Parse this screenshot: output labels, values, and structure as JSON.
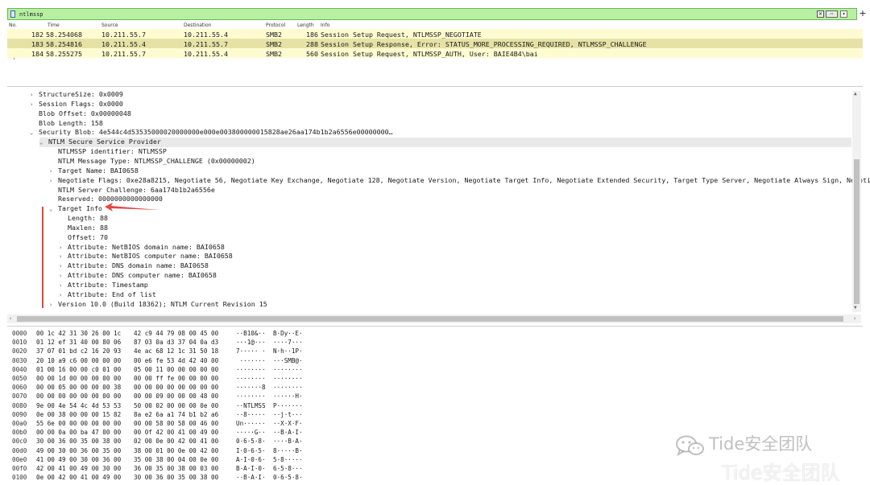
{
  "filter": {
    "value": "ntlmssp",
    "clear_icon": "✕",
    "apply_icon": "⇨",
    "dropdown_icon": "▾",
    "add_icon": "+"
  },
  "packet_list": {
    "columns": [
      "No.",
      "Time",
      "Source",
      "Destination",
      "Protocol",
      "Length",
      "Info"
    ],
    "rows": [
      {
        "no": "182",
        "time": "58.254068",
        "source": "10.211.55.7",
        "destination": "10.211.55.4",
        "protocol": "SMB2",
        "length": "186",
        "info": "Session Setup Request, NTLMSSP_NEGOTIATE"
      },
      {
        "no": "183",
        "time": "58.254816",
        "source": "10.211.55.4",
        "destination": "10.211.55.7",
        "protocol": "SMB2",
        "length": "288",
        "info": "Session Setup Response, Error: STATUS_MORE_PROCESSING_REQUIRED, NTLMSSP_CHALLENGE"
      },
      {
        "no": "184",
        "time": "58.255275",
        "source": "10.211.55.7",
        "destination": "10.211.55.4",
        "protocol": "SMB2",
        "length": "560",
        "info": "Session Setup Request, NTLMSSP_AUTH, User: BAIE4B4\\bai"
      }
    ]
  },
  "details": [
    {
      "indent": 0,
      "arrow": "›",
      "text": "StructureSize: 0x0009"
    },
    {
      "indent": 0,
      "arrow": "›",
      "text": "Session Flags: 0x0000"
    },
    {
      "indent": 0,
      "arrow": "",
      "text": "Blob Offset: 0x00000048"
    },
    {
      "indent": 0,
      "arrow": "",
      "text": "Blob Length: 158"
    },
    {
      "indent": 0,
      "arrow": "⌄",
      "text": "Security Blob: 4e544c4d53535000020000000e000e003800000015828ae26aa174b1b2a6556e00000000…"
    },
    {
      "indent": 1,
      "arrow": "⌄",
      "text": "NTLM Secure Service Provider",
      "selected": true
    },
    {
      "indent": 2,
      "arrow": "",
      "text": "NTLMSSP identifier: NTLMSSP"
    },
    {
      "indent": 2,
      "arrow": "",
      "text": "NTLM Message Type: NTLMSSP_CHALLENGE (0x00000002)"
    },
    {
      "indent": 2,
      "arrow": "›",
      "text": "Target Name: BAI0658"
    },
    {
      "indent": 2,
      "arrow": "›",
      "text": "Negotiate Flags: 0xe28a8215, Negotiate 56, Negotiate Key Exchange, Negotiate 128, Negotiate Version, Negotiate Target Info, Negotiate Extended Security, Target Type Server, Negotiate Always Sign, Negotia"
    },
    {
      "indent": 2,
      "arrow": "",
      "text": "NTLM Server Challenge: 6aa174b1b2a6556e"
    },
    {
      "indent": 2,
      "arrow": "",
      "text": "Reserved: 0000000000000000"
    },
    {
      "indent": 2,
      "arrow": "⌄",
      "text": "Target Info"
    },
    {
      "indent": 3,
      "arrow": "",
      "text": "Length: 88"
    },
    {
      "indent": 3,
      "arrow": "",
      "text": "Maxlen: 88"
    },
    {
      "indent": 3,
      "arrow": "",
      "text": "Offset: 70"
    },
    {
      "indent": 3,
      "arrow": "›",
      "text": "Attribute: NetBIOS domain name: BAI0658"
    },
    {
      "indent": 3,
      "arrow": "›",
      "text": "Attribute: NetBIOS computer name: BAI0658"
    },
    {
      "indent": 3,
      "arrow": "›",
      "text": "Attribute: DNS domain name: BAI0658"
    },
    {
      "indent": 3,
      "arrow": "›",
      "text": "Attribute: DNS computer name: BAI0658"
    },
    {
      "indent": 3,
      "arrow": "›",
      "text": "Attribute: Timestamp"
    },
    {
      "indent": 3,
      "arrow": "›",
      "text": "Attribute: End of list"
    },
    {
      "indent": 2,
      "arrow": "›",
      "text": "Version 10.0 (Build 18362); NTLM Current Revision 15"
    }
  ],
  "hex": [
    {
      "off": "0000",
      "b1": "00 1c 42 31 30 26 00 1c",
      "b2": "42 c9 44 79 08 00 45 00",
      "a1": "··B10&··",
      "a2": "B·Dy··E·"
    },
    {
      "off": "0010",
      "b1": "01 12 ef 31 40 00 80 06",
      "b2": "87 03 0a d3 37 04 0a d3",
      "a1": "···1@···",
      "a2": "····7···"
    },
    {
      "off": "0020",
      "b1": "37 07 01 bd c2 16 20 93",
      "b2": "4e ac 68 12 1c 31 50 18",
      "a1": "7····· ·",
      "a2": "N·h··1P·"
    },
    {
      "off": "0030",
      "b1": "20 10 a9 c6 00 00 00 00",
      "b2": "00 e6 fe 53 4d 42 40 00",
      "a1": " ·······",
      "a2": "···SMB@·"
    },
    {
      "off": "0040",
      "b1": "01 00 16 00 00 c0 01 00",
      "b2": "05 00 11 00 00 00 00 00",
      "a1": "········",
      "a2": "········"
    },
    {
      "off": "0050",
      "b1": "00 00 1d 00 00 00 00 00",
      "b2": "00 00 ff fe 00 00 00 00",
      "a1": "········",
      "a2": "········"
    },
    {
      "off": "0060",
      "b1": "00 00 05 00 00 00 00 38",
      "b2": "00 00 00 00 00 00 00 00",
      "a1": "·······8",
      "a2": "········"
    },
    {
      "off": "0070",
      "b1": "00 00 00 00 00 00 00 00",
      "b2": "00 00 09 00 00 00 48 00",
      "a1": "········",
      "a2": "······H·"
    },
    {
      "off": "0080",
      "b1": "9e 00 4e 54 4c 4d 53 53",
      "b2": "50 00 02 00 00 00 0e 00",
      "a1": "··NTLMSS",
      "a2": "P·······"
    },
    {
      "off": "0090",
      "b1": "0e 00 38 00 00 00 15 82",
      "b2": "8a e2 6a a1 74 b1 b2 a6",
      "a1": "··8·····",
      "a2": "··j·t···"
    },
    {
      "off": "00a0",
      "b1": "55 6e 00 00 00 00 00 00",
      "b2": "00 00 58 00 58 00 46 00",
      "a1": "Un······",
      "a2": "··X·X·F·"
    },
    {
      "off": "00b0",
      "b1": "00 00 0a 00 ba 47 00 00",
      "b2": "00 0f 42 00 41 00 49 00",
      "a1": "·····G··",
      "a2": "··B·A·I·"
    },
    {
      "off": "00c0",
      "b1": "30 00 36 00 35 00 38 00",
      "b2": "02 00 0e 00 42 00 41 00",
      "a1": "0·6·5·8·",
      "a2": "····B·A·"
    },
    {
      "off": "00d0",
      "b1": "49 00 30 00 36 00 35 00",
      "b2": "38 00 01 00 0e 00 42 00",
      "a1": "I·0·6·5·",
      "a2": "8·····B·"
    },
    {
      "off": "00e0",
      "b1": "41 00 49 00 30 00 36 00",
      "b2": "35 00 38 00 04 00 0e 00",
      "a1": "A·I·0·6·",
      "a2": "5·8·····"
    },
    {
      "off": "00f0",
      "b1": "42 00 41 00 49 00 30 00",
      "b2": "36 00 35 00 38 00 03 00",
      "a1": "B·A·I·0·",
      "a2": "6·5·8···"
    },
    {
      "off": "0100",
      "b1": "0e 00 42 00 41 00 49 00",
      "b2": "30 00 36 00 35 00 38 00",
      "a1": "··B·A·I·",
      "a2": "0·6·5·8·"
    }
  ],
  "watermark": {
    "top": "Tide安全团队",
    "bottom": "Tide安全团队",
    "icon": "wechat-icon"
  },
  "colors": {
    "filter_bg": "#b6f0a0",
    "row_bg": "#fefbd0",
    "row_selected_bg": "#e6e2a6",
    "annotation": "#e64545"
  }
}
